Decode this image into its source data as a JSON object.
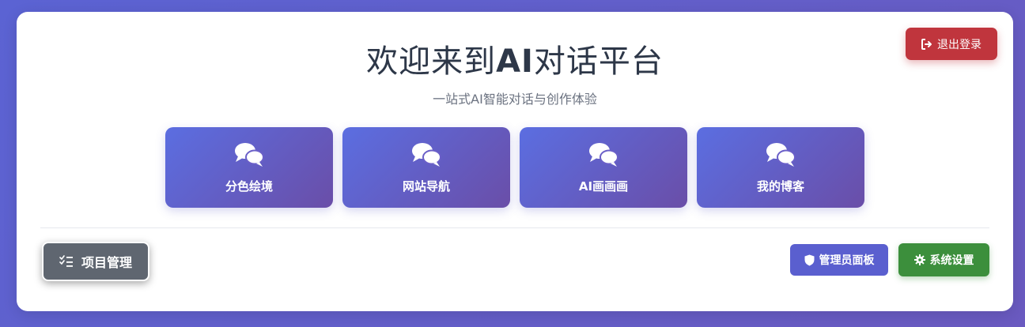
{
  "header": {
    "title_prefix": "欢迎来到",
    "title_ai": "AI",
    "title_suffix": "对话平台",
    "subtitle": "一站式AI智能对话与创作体验",
    "logout_label": "退出登录"
  },
  "features": [
    {
      "label": "分色绘境",
      "icon": "chat-bubbles-icon"
    },
    {
      "label": "网站导航",
      "icon": "chat-bubbles-icon"
    },
    {
      "label": "AI画画画",
      "icon": "chat-bubbles-icon"
    },
    {
      "label": "我的博客",
      "icon": "chat-bubbles-icon"
    }
  ],
  "footer": {
    "project_label": "项目管理",
    "admin_label": "管理员面板",
    "settings_label": "系统设置"
  },
  "colors": {
    "background_gradient_start": "#5b63d3",
    "background_gradient_end": "#6a5ac0",
    "logout": "#c0353d",
    "feature_start": "#5b6ee1",
    "feature_end": "#6a4ea8",
    "project": "#5f6670",
    "admin": "#5a5fcf",
    "settings": "#3c8f3c"
  }
}
